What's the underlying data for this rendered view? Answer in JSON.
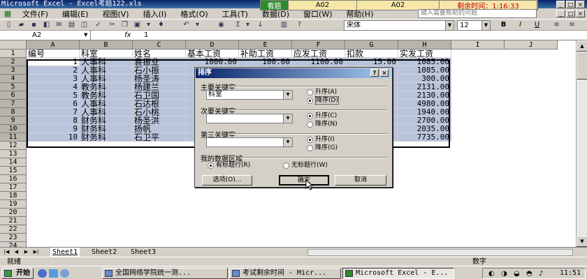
{
  "window": {
    "title": "Microsoft Excel - Excel考题122.xls"
  },
  "exam": {
    "kind": "看题",
    "cell1": "A02",
    "cell2": "A02",
    "timer": "剩余时间：1:16:33"
  },
  "menu": [
    "文件(F)",
    "编辑(E)",
    "视图(V)",
    "插入(I)",
    "格式(O)",
    "工具(T)",
    "数据(D)",
    "窗口(W)",
    "帮助(H)"
  ],
  "help_placeholder": "键入需要帮助的问题",
  "toolbar": {
    "font": "宋体",
    "size": "12",
    "bold": "B",
    "italic": "I",
    "underline": "U"
  },
  "formula": {
    "namebox": "A2",
    "fx": "fx",
    "value": "1"
  },
  "columns": [
    "A",
    "B",
    "C",
    "D",
    "E",
    "F",
    "G",
    "H",
    "I",
    "J"
  ],
  "rows": [
    "1",
    "2",
    "3",
    "4",
    "5",
    "6",
    "7",
    "8",
    "9",
    "10",
    "11",
    "12",
    "13",
    "14",
    "15",
    "16",
    "17",
    "18",
    "19",
    "20",
    "21",
    "22",
    "23",
    "24"
  ],
  "table": {
    "headers": [
      "编号",
      "科室",
      "姓名",
      "基本工资",
      "补助工资",
      "应发工资",
      "扣款",
      "实发工资"
    ],
    "rows": [
      [
        "1",
        "人事科",
        "袁振业",
        "1000.00",
        "100.00",
        "1100.00",
        "15.00",
        "1085.00"
      ],
      [
        "2",
        "人事科",
        "石小振",
        "",
        "",
        "",
        "",
        "1085.00"
      ],
      [
        "3",
        "人事科",
        "杨圣涛",
        "",
        "",
        "",
        "",
        "300.00"
      ],
      [
        "4",
        "教务科",
        "杨建兰",
        "",
        "",
        "",
        "",
        "2131.00"
      ],
      [
        "5",
        "教务科",
        "石卫国",
        "",
        "",
        "",
        "",
        "2130.00"
      ],
      [
        "6",
        "人事科",
        "石达根",
        "",
        "",
        "",
        "",
        "4980.00"
      ],
      [
        "7",
        "人事科",
        "石小桃",
        "",
        "",
        "",
        "",
        "1940.00"
      ],
      [
        "8",
        "财务科",
        "杨圣洪",
        "",
        "",
        "",
        "",
        "2700.00"
      ],
      [
        "9",
        "财务科",
        "扬帆",
        "",
        "",
        "",
        "",
        "2035.00"
      ],
      [
        "10",
        "财务科",
        "石卫平",
        "",
        "",
        "",
        "",
        "7735.00"
      ]
    ]
  },
  "sheets": [
    "Sheet1",
    "Sheet2",
    "Sheet3"
  ],
  "status": {
    "left": "就绪",
    "right": "数字"
  },
  "taskbar": {
    "start": "开始",
    "tasks": [
      "全国网络学院统一测...",
      "考试剩余时间 - Micr...",
      "Microsoft Excel - E..."
    ],
    "clock": "11:51"
  },
  "dialog": {
    "title": "排序",
    "key1": {
      "label": "主要关键字",
      "value": "科室",
      "asc": "升序(A)",
      "desc": "降序(D)"
    },
    "key2": {
      "label": "次要关键字",
      "value": "",
      "asc": "升序(C)",
      "desc": "降序(N)"
    },
    "key3": {
      "label": "第三关键字",
      "value": "",
      "asc": "升序(I)",
      "desc": "降序(G)"
    },
    "range": {
      "label": "我的数据区域",
      "header": "有标题行(R)",
      "noheader": "无标题行(W)"
    },
    "options": "选项(O)...",
    "ok": "确定",
    "cancel": "取消"
  }
}
